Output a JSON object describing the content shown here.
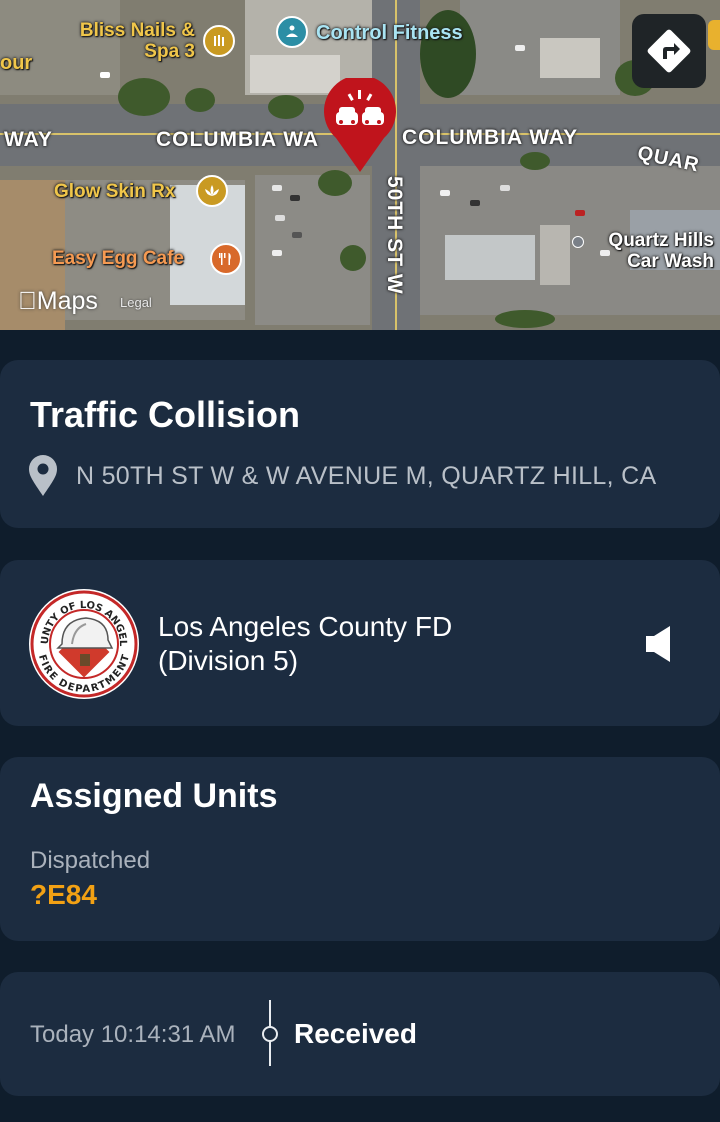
{
  "map": {
    "pois": {
      "bliss_nails": "Bliss Nails &\nSpa 3",
      "control_fitness": "Control Fitness",
      "glow_skin": "Glow Skin Rx",
      "easy_egg": "Easy Egg Cafe",
      "quartz_hills": "Quartz Hills\nCar Wash",
      "partial_left": "our"
    },
    "streets": {
      "columbia_left": "WAY",
      "columbia_mid": "COLUMBIA WA",
      "columbia_right": "COLUMBIA WAY",
      "quartz": "QUAR",
      "fiftieth": "50TH ST W"
    },
    "attribution": {
      "maps": "Maps",
      "legal": "Legal"
    },
    "colors": {
      "pin": "#c0141c",
      "gold_poi": "#c99a22",
      "teal_poi": "#2c8ea5",
      "orange_poi": "#d8692a"
    }
  },
  "incident": {
    "title": "Traffic Collision",
    "location": "N 50TH ST W & W AVENUE M, QUARTZ HILL, CA",
    "icon": "location-pin-icon"
  },
  "department": {
    "name_line1": "Los Angeles County FD",
    "name_line2": "(Division 5)",
    "seal_text_top": "COUNTY OF LOS ANGELES",
    "seal_text_bottom": "FIRE DEPARTMENT",
    "speaker_icon": "speaker-icon"
  },
  "units": {
    "title": "Assigned Units",
    "status": "Dispatched",
    "code": "?E84",
    "accent": "#f2a114"
  },
  "timeline": {
    "time": "Today 10:14:31 AM",
    "label": "Received"
  }
}
